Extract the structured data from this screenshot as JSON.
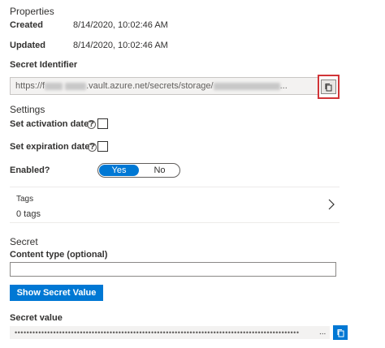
{
  "properties": {
    "title": "Properties",
    "created_label": "Created",
    "created_value": "8/14/2020, 10:02:46 AM",
    "updated_label": "Updated",
    "updated_value": "8/14/2020, 10:02:46 AM",
    "secret_identifier_label": "Secret Identifier",
    "secret_identifier_prefix": "https://f",
    "secret_identifier_middle": ".vault.azure.net/secrets/storage/",
    "secret_identifier_suffix": "...",
    "copy_icon": "copy-icon"
  },
  "settings": {
    "title": "Settings",
    "activation_label": "Set activation date?",
    "expiration_label": "Set expiration date?",
    "info_glyph": "i",
    "enabled_label": "Enabled?",
    "toggle_yes": "Yes",
    "toggle_no": "No",
    "toggle_selected": "Yes"
  },
  "tags": {
    "title": "Tags",
    "count": "0 tags",
    "chevron_icon": "chevron-right-icon"
  },
  "secret": {
    "title": "Secret",
    "content_type_label": "Content type (optional)",
    "content_type_value": "",
    "show_button_label": "Show Secret Value",
    "secret_value_label": "Secret value",
    "secret_value_masked": "••••••••••••••••••••••••••••••••••••••••••••••••••••••••••••••••••••••••••••••••••••••••••••••••",
    "secret_value_suffix": "..."
  },
  "colors": {
    "accent": "#0078d4",
    "highlight": "#d13438"
  }
}
